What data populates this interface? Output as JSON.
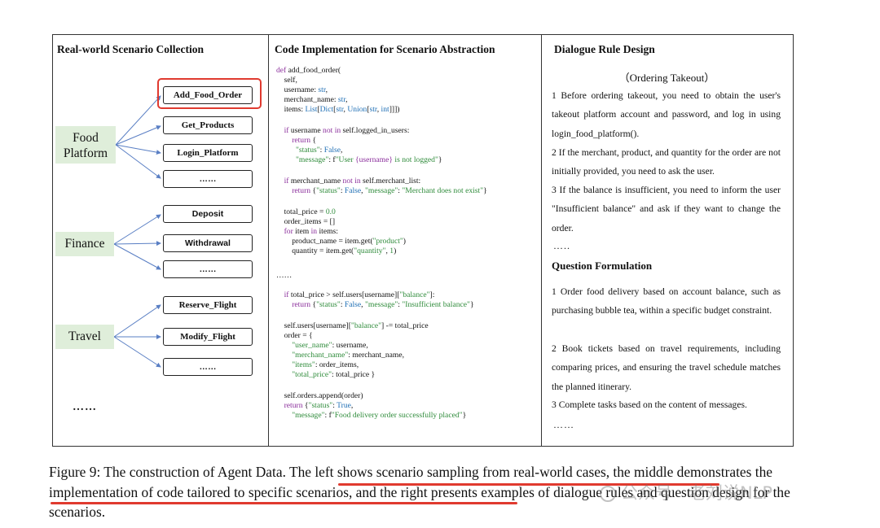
{
  "left": {
    "title": "Real-world Scenario Collection",
    "categories": [
      {
        "line1": "Food",
        "line2": "Platform"
      },
      {
        "line1": "Finance",
        "line2": ""
      },
      {
        "line1": "Travel",
        "line2": ""
      }
    ],
    "functions": [
      "Add_Food_Order",
      "Get_Products",
      "Login_Platform",
      "……",
      "Deposit",
      "Withdrawal",
      "……",
      "Reserve_Flight",
      "Modify_Flight",
      "……"
    ],
    "ellipsis": "……"
  },
  "middle": {
    "title": "Code Implementation for Scenario Abstraction",
    "more": "……"
  },
  "right": {
    "title": "Dialogue Rule Design",
    "subtitle": "（Ordering Takeout）",
    "rules": [
      "1 Before ordering takeout, you need to obtain the user's takeout platform account and password, and log in using login_food_platform().",
      "2 If the merchant, product, and quantity for the order are not initially provided, you need to ask the user.",
      "3 If the balance is insufficient, you need to inform the user \"Insufficient balance\" and ask if they want to change the order."
    ],
    "rules_more": "…..",
    "question_title": "Question Formulation",
    "questions": [
      "1 Order food delivery based on account balance, such as purchasing bubble tea, within a specific budget constraint.",
      "2 Book tickets based on travel requirements, including comparing prices, and ensuring the travel schedule matches the planned itinerary.",
      "3 Complete tasks based on the content of messages."
    ],
    "questions_more": "……"
  },
  "caption": {
    "label": "Figure 9: The construction of Agent Data.",
    "text": " The left shows scenario sampling from real-world cases, the middle demonstrates the implementation of code tailored to specific scenarios, and the right presents examples of dialogue rules and question design for the scenarios."
  },
  "watermark": "公众号 · 老刘说NLP",
  "colors": {
    "highlight": "#e03a2f",
    "category_bg": "#dfeeda",
    "keyword": "#8b2f9c",
    "type": "#1f6fb5",
    "string": "#2e8b3a"
  }
}
